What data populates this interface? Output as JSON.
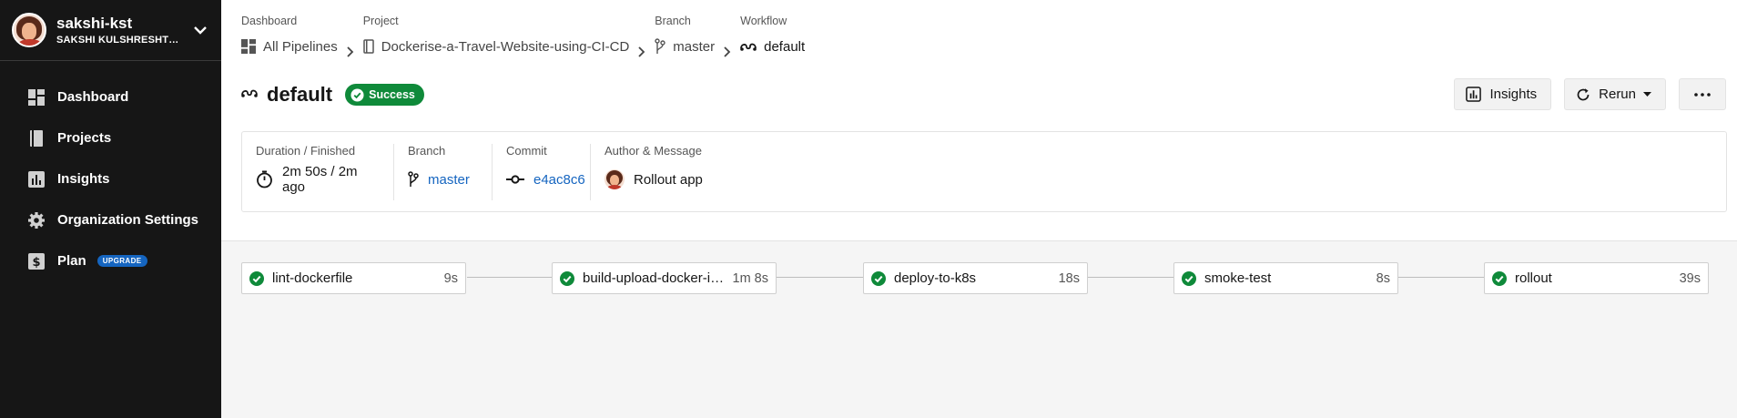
{
  "sidebar": {
    "org_name": "sakshi-kst",
    "org_sub": "SAKSHI KULSHRESHTHA",
    "items": [
      {
        "label": "Dashboard",
        "icon": "dashboard-icon"
      },
      {
        "label": "Projects",
        "icon": "book-icon"
      },
      {
        "label": "Insights",
        "icon": "insights-icon"
      },
      {
        "label": "Organization Settings",
        "icon": "gear-icon"
      },
      {
        "label": "Plan",
        "icon": "dollar-icon",
        "badge": "UPGRADE"
      }
    ]
  },
  "breadcrumb": [
    {
      "label": "Dashboard",
      "value": "All Pipelines",
      "icon": "dashboard-icon"
    },
    {
      "label": "Project",
      "value": "Dockerise-a-Travel-Website-using-CI-CD",
      "icon": "book-icon"
    },
    {
      "label": "Branch",
      "value": "master",
      "icon": "branch-icon"
    },
    {
      "label": "Workflow",
      "value": "default",
      "icon": "workflow-icon"
    }
  ],
  "workflow": {
    "title": "default",
    "status": "Success",
    "status_color": "#0f8a3a"
  },
  "actions": {
    "insights": "Insights",
    "rerun": "Rerun",
    "more": "•••"
  },
  "summary": {
    "duration_label": "Duration / Finished",
    "duration_value": "2m 50s / 2m ago",
    "branch_label": "Branch",
    "branch_value": "master",
    "commit_label": "Commit",
    "commit_value": "e4ac8c6",
    "author_label": "Author & Message",
    "author_message": "Rollout app"
  },
  "jobs": [
    {
      "name": "lint-dockerfile",
      "duration": "9s"
    },
    {
      "name": "build-upload-docker-image",
      "duration": "1m 8s"
    },
    {
      "name": "deploy-to-k8s",
      "duration": "18s"
    },
    {
      "name": "smoke-test",
      "duration": "8s"
    },
    {
      "name": "rollout",
      "duration": "39s"
    }
  ],
  "colors": {
    "sidebar_bg": "#161616",
    "success": "#0f8a3a",
    "link": "#1565c0",
    "upgrade": "#1565c0"
  }
}
